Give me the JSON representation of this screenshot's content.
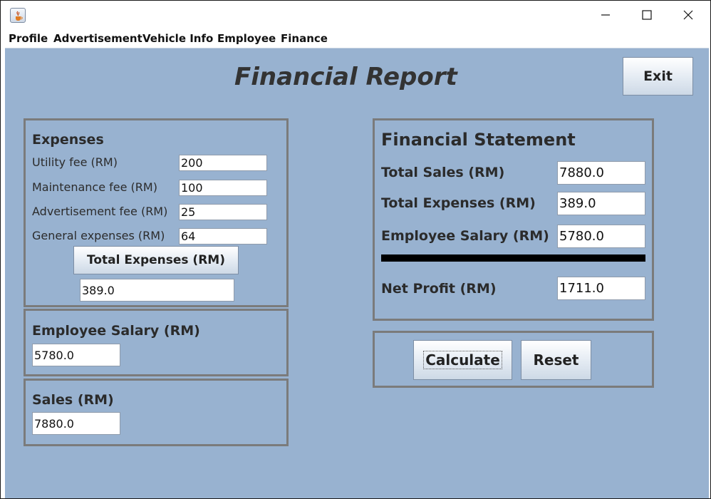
{
  "window": {
    "icon": "java-cup-icon",
    "controls": [
      "minimize-icon",
      "maximize-icon",
      "close-icon"
    ]
  },
  "menu": {
    "items": [
      {
        "label": "Profile"
      },
      {
        "label": "Advertisement"
      },
      {
        "label": "Vehicle Info"
      },
      {
        "label": "Employee"
      },
      {
        "label": "Finance"
      }
    ]
  },
  "header": {
    "title": "Financial Report",
    "exit_label": "Exit"
  },
  "expenses": {
    "heading": "Expenses",
    "utility_label": "Utility fee (RM)",
    "utility_value": "200",
    "maintenance_label": "Maintenance fee (RM)",
    "maintenance_value": "100",
    "advertisement_label": "Advertisement fee (RM)",
    "advertisement_value": "25",
    "general_label": "General expenses (RM)",
    "general_value": "64",
    "total_button_label": "Total Expenses (RM)",
    "total_value": "389.0"
  },
  "salary": {
    "heading": "Employee Salary (RM)",
    "value": "5780.0"
  },
  "sales": {
    "heading": "Sales (RM)",
    "value": "7880.0"
  },
  "statement": {
    "heading": "Financial Statement",
    "total_sales_label": "Total Sales (RM)",
    "total_sales_value": "7880.0",
    "total_expenses_label": "Total Expenses (RM)",
    "total_expenses_value": "389.0",
    "employee_salary_label": "Employee Salary (RM)",
    "employee_salary_value": "5780.0",
    "net_profit_label": "Net Profit (RM)",
    "net_profit_value": "1711.0"
  },
  "actions": {
    "calculate_label": "Calculate",
    "reset_label": "Reset"
  },
  "colors": {
    "background": "#98b2d0",
    "panel_border": "#7b7b7b",
    "divider": "#000000"
  }
}
